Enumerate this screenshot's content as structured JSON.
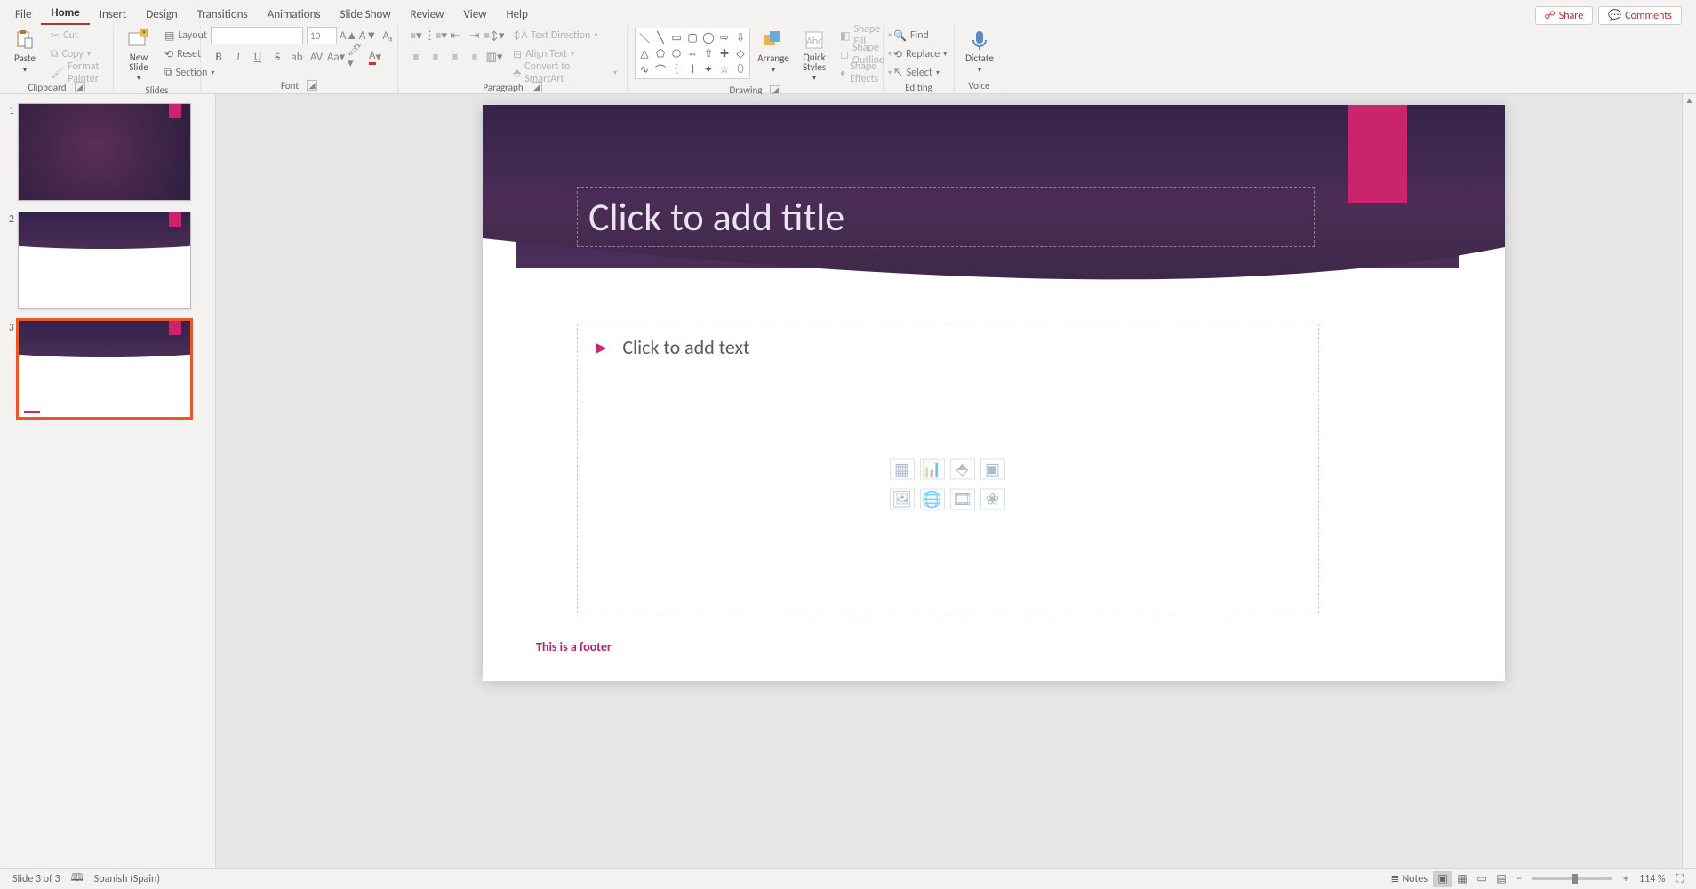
{
  "tabs": [
    "File",
    "Home",
    "Insert",
    "Design",
    "Transitions",
    "Animations",
    "Slide Show",
    "Review",
    "View",
    "Help"
  ],
  "active_tab": "Home",
  "share_label": "Share",
  "comments_label": "Comments",
  "clipboard": {
    "paste": "Paste",
    "cut": "Cut",
    "copy": "Copy",
    "painter": "Format Painter",
    "label": "Clipboard"
  },
  "slides_group": {
    "new": "New Slide",
    "layout": "Layout",
    "reset": "Reset",
    "section": "Section",
    "label": "Slides"
  },
  "font_group": {
    "name_ph": "",
    "size": "10",
    "label": "Font"
  },
  "paragraph_group": {
    "textdir": "Text Direction",
    "align": "Align Text",
    "smartart": "Convert to SmartArt",
    "label": "Paragraph"
  },
  "drawing_group": {
    "arrange": "Arrange",
    "quick": "Quick Styles",
    "fill": "Shape Fill",
    "outline": "Shape Outline",
    "effects": "Shape Effects",
    "label": "Drawing"
  },
  "editing_group": {
    "find": "Find",
    "replace": "Replace",
    "select": "Select",
    "label": "Editing"
  },
  "voice_group": {
    "dictate": "Dictate",
    "label": "Voice"
  },
  "thumbnails": [
    {
      "num": "1",
      "kind": "title",
      "selected": false
    },
    {
      "num": "2",
      "kind": "content",
      "selected": false
    },
    {
      "num": "3",
      "kind": "content",
      "selected": true
    }
  ],
  "slide": {
    "title_placeholder": "Click to add title",
    "text_placeholder": "Click to add text",
    "footer": "This is a footer"
  },
  "status": {
    "slide": "Slide 3 of 3",
    "lang": "Spanish (Spain)",
    "notes": "Notes",
    "zoom": "114 %"
  }
}
